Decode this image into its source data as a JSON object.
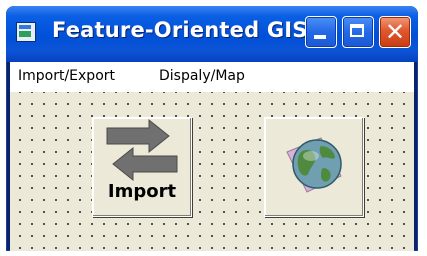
{
  "window": {
    "title": "Feature-Oriented GIS",
    "icon": "app-icon",
    "controls": {
      "minimize": "minimize-icon",
      "maximize": "maximize-icon",
      "close_glyph": "✕"
    }
  },
  "menu": {
    "items": [
      "Import/Export",
      "Dispaly/Map"
    ]
  },
  "buttons": {
    "import": {
      "label": "Import",
      "icon": "swap-arrows-icon"
    },
    "display": {
      "icon": "globe-icon"
    }
  },
  "colors": {
    "titlebar": "#0050d8",
    "close": "#e0582e",
    "form_bg": "#ece9d8"
  }
}
